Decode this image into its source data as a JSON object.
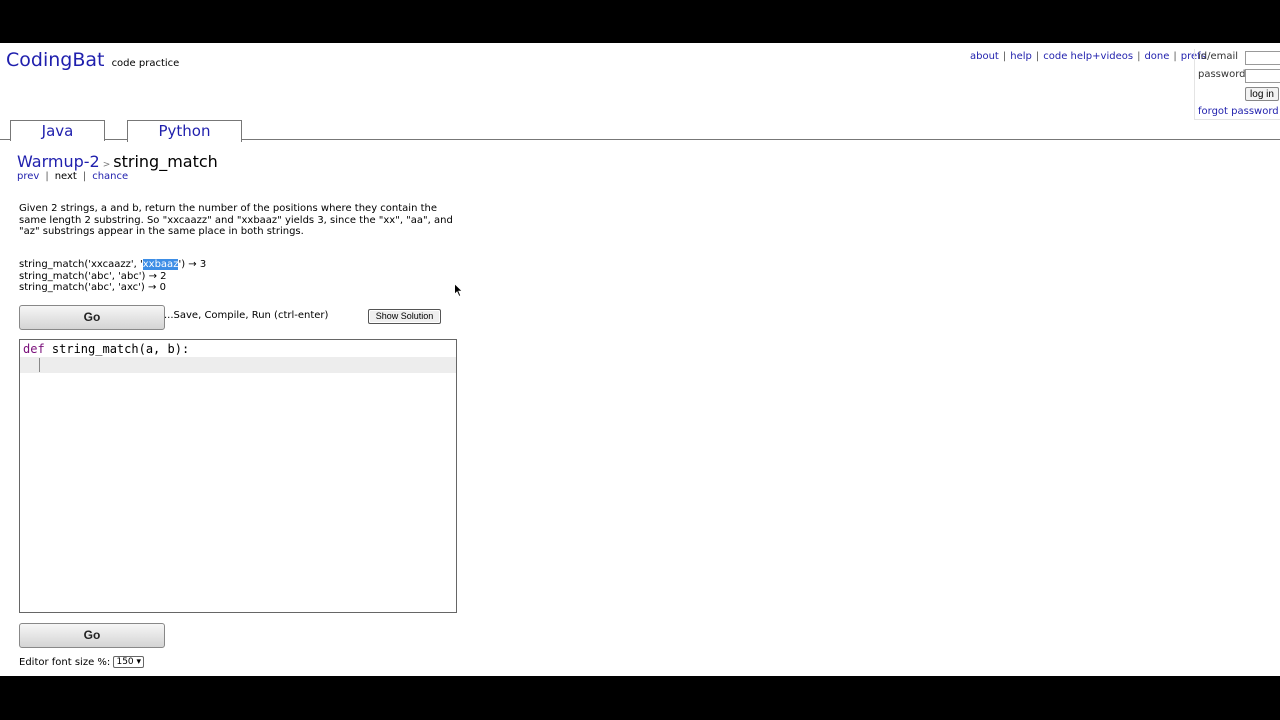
{
  "header": {
    "brand": "CodingBat",
    "tagline": "code practice",
    "links": [
      "about",
      "help",
      "code help+videos",
      "done",
      "prefs"
    ]
  },
  "login": {
    "id_label": "id/email",
    "password_label": "password",
    "login_button": "log in",
    "forgot": "forgot password |"
  },
  "tabs": [
    {
      "label": "Java",
      "active": false
    },
    {
      "label": "Python",
      "active": true
    }
  ],
  "breadcrumb": {
    "parent": "Warmup-2",
    "separator": ">",
    "title": "string_match"
  },
  "nav": {
    "prev": "prev",
    "next": "next",
    "chance": "chance"
  },
  "problem": {
    "description": "Given 2 strings, a and b, return the number of the positions where they contain the same length 2 substring. So \"xxcaazz\" and \"xxbaaz\" yields 3, since the \"xx\", \"aa\", and \"az\" substrings appear in the same place in both strings.",
    "examples": {
      "ex1_pre": "string_match('xxcaazz', '",
      "ex1_hl": "xxbaaz",
      "ex1_post": "') → 3",
      "ex2": "string_match('abc', 'abc') → 2",
      "ex3": "string_match('abc', 'axc') → 0"
    }
  },
  "controls": {
    "go": "Go",
    "run_hint": "...Save, Compile, Run (ctrl-enter)",
    "show_solution": "Show Solution",
    "font_label": "Editor font size %:",
    "font_value": "150"
  },
  "editor": {
    "keyword": "def",
    "rest": " string_match(a, b):"
  },
  "colors": {
    "link": "#1f1fad",
    "selection": "#3d8ee6",
    "keyword": "#7a0f7a"
  }
}
